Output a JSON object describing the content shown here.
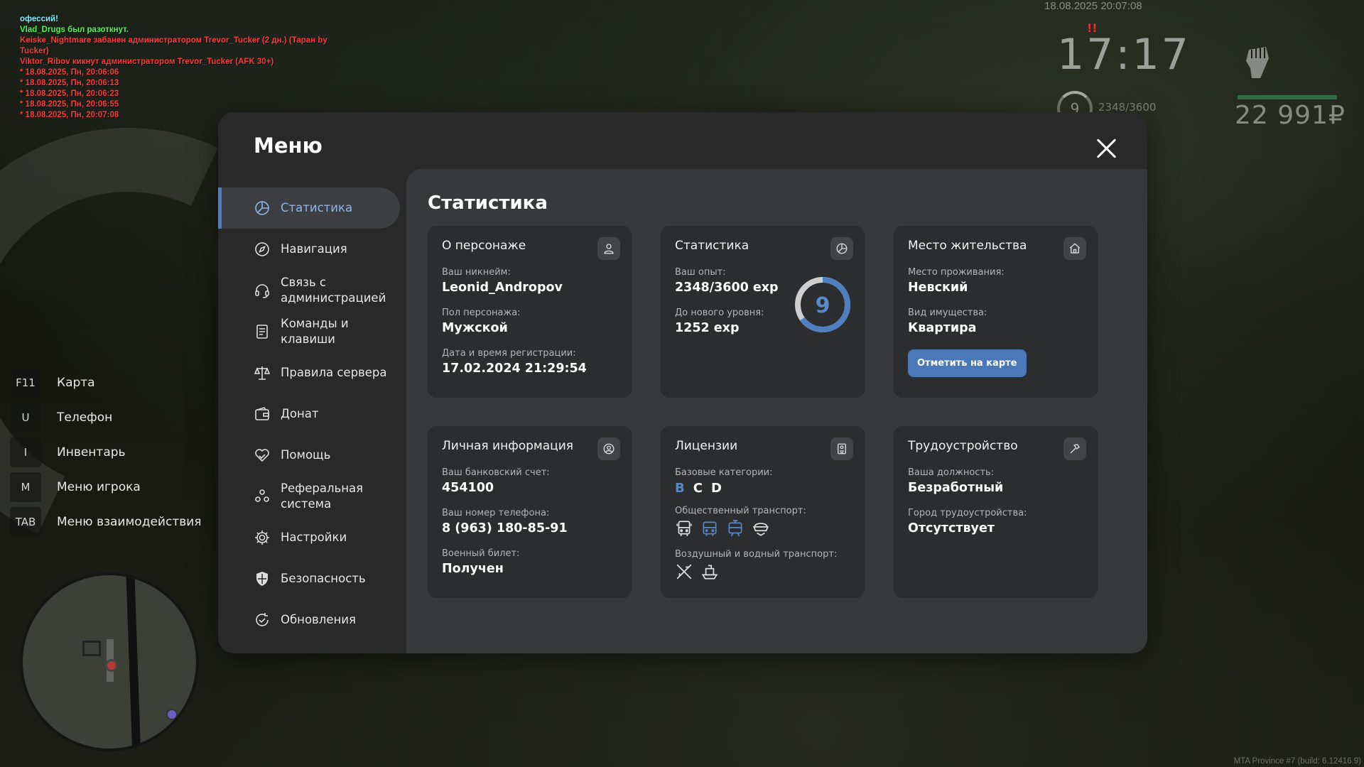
{
  "chat": [
    {
      "text": "офессий!",
      "color": "cyan"
    },
    {
      "text": "Vlad_Drugs был разоткнут.",
      "color": "green"
    },
    {
      "text": "Keiske_Nightmare забанен администратором Trevor_Tucker (2 дн.) (Таран by",
      "color": "red"
    },
    {
      "text": " Tucker)",
      "color": "red"
    },
    {
      "text": "Viktor_Ribov кикнут администратором Trevor_Tucker (AFK 30+)",
      "color": "red"
    },
    {
      "text": "* 18.08.2025, Пн, 20:06:06",
      "color": "red"
    },
    {
      "text": "* 18.08.2025, Пн, 20:06:13",
      "color": "red"
    },
    {
      "text": "* 18.08.2025, Пн, 20:06:23",
      "color": "red"
    },
    {
      "text": "* 18.08.2025, Пн, 20:06:55",
      "color": "red"
    },
    {
      "text": "* 18.08.2025, Пн, 20:07:08",
      "color": "red"
    }
  ],
  "hud": {
    "datetime": "18.08.2025 20:07:08",
    "wanted": "!!",
    "time": "17:17",
    "level": "9",
    "exp": "2348/3600",
    "money": "22 991₽"
  },
  "keys": [
    {
      "key": "F11",
      "label": "Карта"
    },
    {
      "key": "U",
      "label": "Телефон"
    },
    {
      "key": "I",
      "label": "Инвентарь"
    },
    {
      "key": "M",
      "label": "Меню игрока"
    },
    {
      "key": "TAB",
      "label": "Меню взаимодействия"
    }
  ],
  "build": "MTA Province #7 (build: 6.12416.9)",
  "menu": {
    "title": "Меню",
    "nav": [
      {
        "label": "Статистика",
        "icon": "stats-icon",
        "active": true
      },
      {
        "label": "Навигация",
        "icon": "compass-icon"
      },
      {
        "label": "Связь с администрацией",
        "icon": "headset-icon"
      },
      {
        "label": "Команды и клавиши",
        "icon": "document-icon"
      },
      {
        "label": "Правила сервера",
        "icon": "scales-icon"
      },
      {
        "label": "Донат",
        "icon": "wallet-icon"
      },
      {
        "label": "Помощь",
        "icon": "heart-hand-icon"
      },
      {
        "label": "Реферальная система",
        "icon": "people-icon"
      },
      {
        "label": "Настройки",
        "icon": "gear-icon"
      },
      {
        "label": "Безопасность",
        "icon": "shield-icon"
      },
      {
        "label": "Обновления",
        "icon": "refresh-check-icon"
      }
    ]
  },
  "stats": {
    "title": "Статистика",
    "character": {
      "title": "О персонаже",
      "nick_label": "Ваш никнейм:",
      "nick": "Leonid_Andropov",
      "gender_label": "Пол персонажа:",
      "gender": "Мужской",
      "reg_label": "Дата и время регистрации:",
      "reg": "17.02.2024 21:29:54"
    },
    "statistics": {
      "title": "Статистика",
      "exp_label": "Ваш опыт:",
      "exp": "2348/3600 exp",
      "next_label": "До нового уровня:",
      "next": "1252 exp",
      "level": "9",
      "progress": 0.652
    },
    "residence": {
      "title": "Место жительства",
      "place_label": "Место проживания:",
      "place": "Невский",
      "property_label": "Вид имущества:",
      "property": "Квартира",
      "button": "Отметить на карте"
    },
    "personal": {
      "title": "Личная информация",
      "bank_label": "Ваш банковский счет:",
      "bank": "454100",
      "phone_label": "Ваш номер телефона:",
      "phone": "8 (963) 180-85-91",
      "military_label": "Военный билет:",
      "military": "Получен"
    },
    "licenses": {
      "title": "Лицензии",
      "base_label": "Базовые категории:",
      "categories": [
        {
          "letter": "B",
          "owned": false
        },
        {
          "letter": "C",
          "owned": true
        },
        {
          "letter": "D",
          "owned": true
        }
      ],
      "public_label": "Общественный транспорт:",
      "public_icons": [
        "bus-icon",
        "trolleybus-icon",
        "tram-icon",
        "taxi-icon"
      ],
      "air_label": "Воздушный и водный транспорт:",
      "air_icons": [
        "plane-icon",
        "boat-icon"
      ]
    },
    "job": {
      "title": "Трудоустройство",
      "position_label": "Ваша должность:",
      "position": "Безработный",
      "city_label": "Город трудоустройства:",
      "city": "Отсутствует"
    }
  },
  "colors": {
    "accent": "#4c80c4",
    "muted_license": "#5a86c4",
    "panel": "#29292a",
    "card": "#2c2d2f"
  }
}
